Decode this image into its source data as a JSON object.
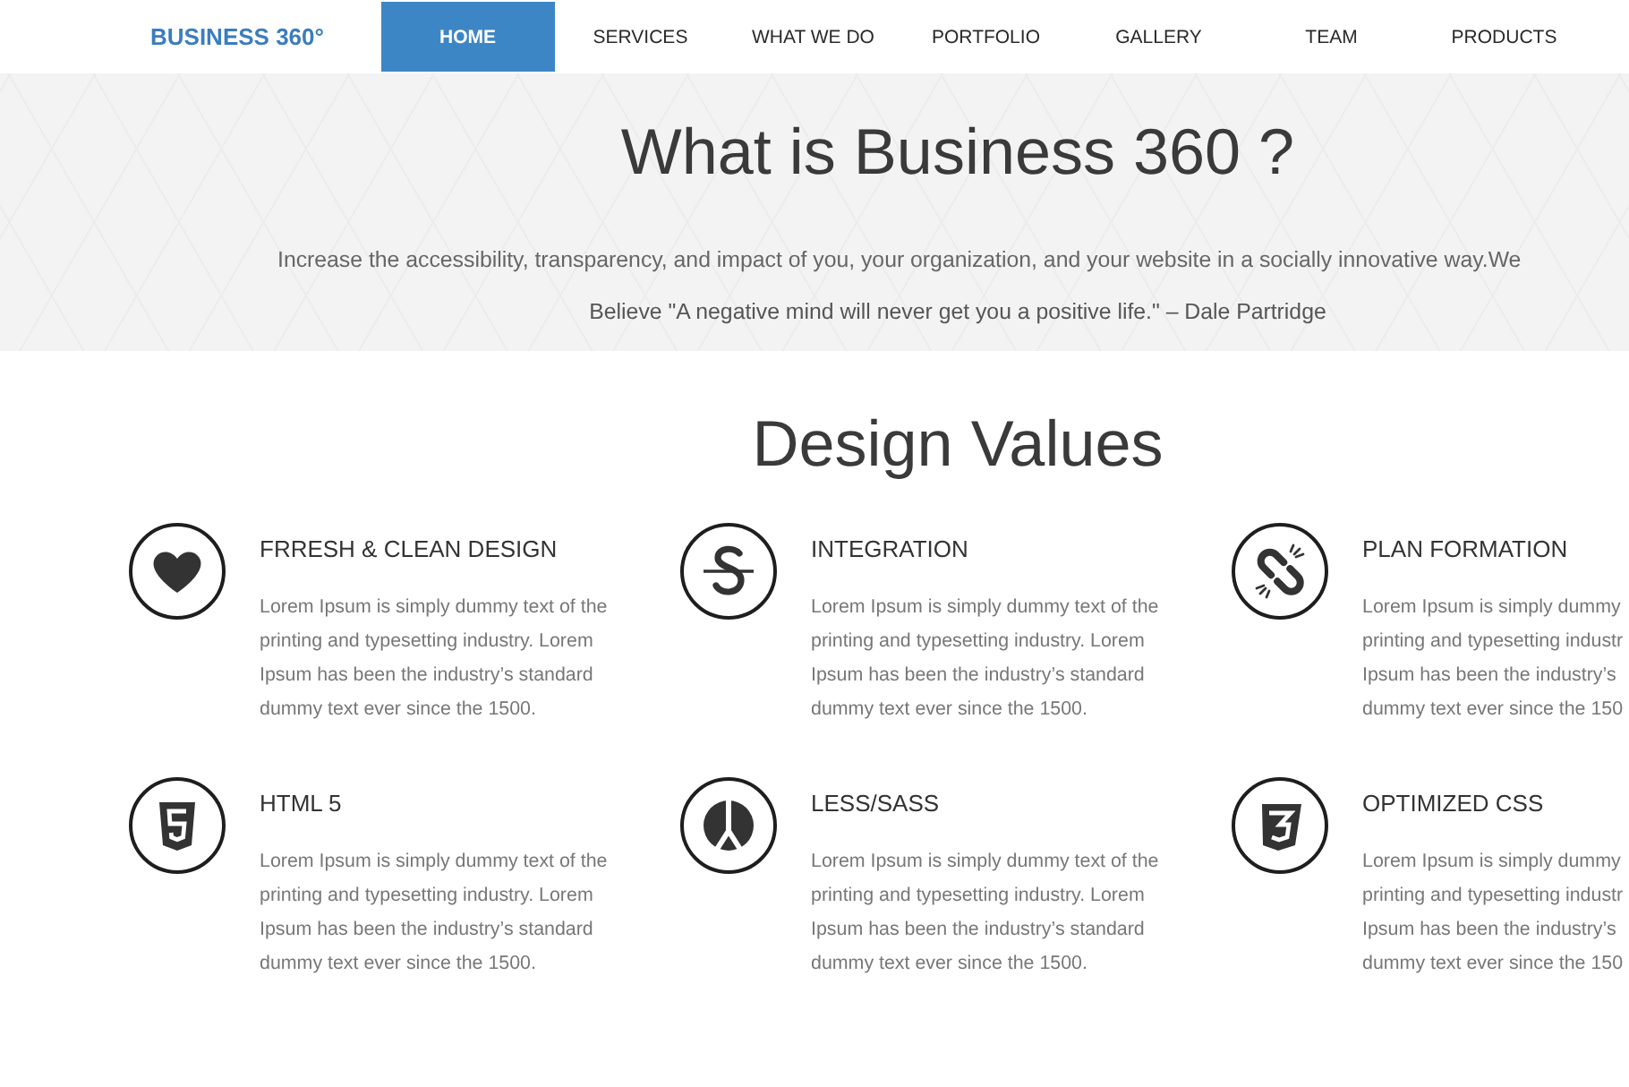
{
  "nav": {
    "logo": "BUSINESS 360°",
    "items": [
      {
        "label": "HOME",
        "selected": true
      },
      {
        "label": "SERVICES",
        "selected": false
      },
      {
        "label": "WHAT WE DO",
        "selected": false
      },
      {
        "label": "PORTFOLIO",
        "selected": false
      },
      {
        "label": "GALLERY",
        "selected": false
      },
      {
        "label": "TEAM",
        "selected": false
      },
      {
        "label": "PRODUCTS",
        "selected": false
      }
    ]
  },
  "hero": {
    "title": "What is Business 360 ?",
    "tagline": "Increase the accessibility, transparency, and impact of you, your organization, and your website in a socially innovative way.We",
    "quote": "Believe \"A negative mind will never get you a positive life.\" – Dale Partridge"
  },
  "design_values": {
    "heading": "Design Values",
    "cards": [
      {
        "title": "FRRESH & CLEAN DESIGN",
        "description_lines": [
          "Lorem Ipsum is simply dummy text of the",
          "printing and typesetting industry. Lorem",
          "Ipsum has been the industry’s standard",
          "dummy text ever since the 1500."
        ]
      },
      {
        "title": "INTEGRATION",
        "description_lines": [
          "Lorem Ipsum is simply dummy text of the",
          "printing and typesetting industry. Lorem",
          "Ipsum has been the industry’s standard",
          "dummy text ever since the 1500."
        ]
      },
      {
        "title": "PLAN FORMATION",
        "description_lines": [
          "Lorem Ipsum is simply dummy",
          "printing and typesetting industr",
          "Ipsum has been the industry’s",
          "dummy text ever since the 150"
        ]
      },
      {
        "title": "HTML 5",
        "description_lines": [
          "Lorem Ipsum is simply dummy text of the",
          "printing and typesetting industry. Lorem",
          "Ipsum has been the industry’s standard",
          "dummy text ever since the 1500."
        ]
      },
      {
        "title": "LESS/SASS",
        "description_lines": [
          "Lorem Ipsum is simply dummy text of the",
          "printing and typesetting industry. Lorem",
          "Ipsum has been the industry’s standard",
          "dummy text ever since the 1500."
        ]
      },
      {
        "title": "OPTIMIZED CSS",
        "description_lines": [
          "Lorem Ipsum is simply dummy",
          "printing and typesetting industr",
          "Ipsum has been the industry’s",
          "dummy text ever since the 150"
        ]
      }
    ]
  }
}
